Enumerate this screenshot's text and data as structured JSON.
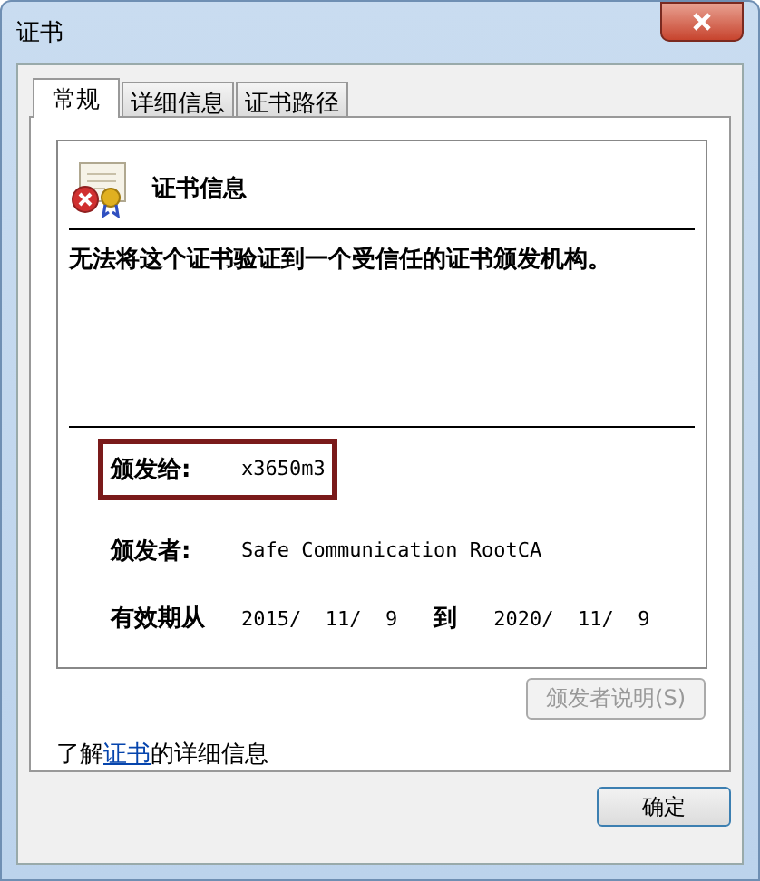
{
  "window": {
    "title": "证书"
  },
  "tabs": [
    {
      "label": "常规",
      "selected": true
    },
    {
      "label": "详细信息",
      "selected": false
    },
    {
      "label": "证书路径",
      "selected": false
    }
  ],
  "info": {
    "heading": "证书信息",
    "message": "无法将这个证书验证到一个受信任的证书颁发机构。",
    "fields": [
      {
        "label": "颁发给:",
        "value": "x3650m3",
        "highlighted": true
      },
      {
        "label": "颁发者:",
        "value": "Safe Communication RootCA"
      }
    ],
    "validity": {
      "label": "有效期从",
      "from": "2015/  11/  9",
      "to_label": "到",
      "to": "2020/  11/  9"
    }
  },
  "issuer_statement_button": {
    "label": "颁发者说明(S)",
    "disabled": true
  },
  "learn_more": {
    "before": "了解",
    "link": "证书",
    "after": "的详细信息"
  },
  "ok_button": {
    "label": "确定"
  }
}
